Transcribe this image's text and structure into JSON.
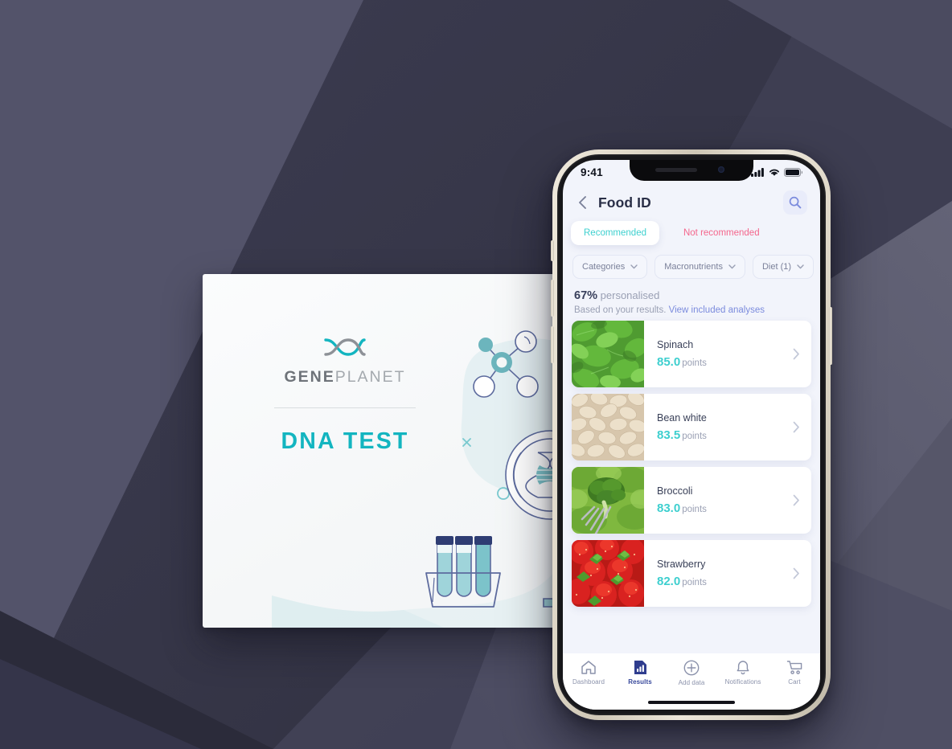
{
  "background": {
    "style": "low-poly-dark-polygons",
    "base_color": "#4a4a5e",
    "dark_color": "#35354a",
    "light_color": "#5a5a70"
  },
  "promo_card": {
    "brand_bold": "GENE",
    "brand_light": "PLANET",
    "product_title": "DNA TEST",
    "logo_icon": "dna-helix-icon",
    "accent_color": "#13b5c0",
    "illustration_items": [
      "molecule-icon",
      "dna-magnifier-icon",
      "test-tubes-icon",
      "microscope-icon",
      "cross-mark-icon",
      "small-circle-icon"
    ]
  },
  "phone": {
    "status_bar": {
      "time": "9:41",
      "signal_icon": "cellular-bars-icon",
      "wifi_icon": "wifi-icon",
      "battery_icon": "battery-full-icon"
    },
    "header": {
      "back_icon": "chevron-left-icon",
      "title": "Food ID",
      "search_icon": "search-icon"
    },
    "segments": [
      {
        "label": "Recommended",
        "active": true,
        "color": "#3ed0cf"
      },
      {
        "label": "Not recommended",
        "active": false,
        "color": "#f4668c"
      }
    ],
    "filters": [
      {
        "label": "Categories",
        "icon": "chevron-down-icon"
      },
      {
        "label": "Macronutrients",
        "icon": "chevron-down-icon"
      },
      {
        "label": "Diet (1)",
        "icon": "chevron-down-icon"
      }
    ],
    "personalised": {
      "percent": "67%",
      "percent_suffix": "personalised",
      "subtitle": "Based on your results.",
      "link": "View included analyses"
    },
    "foods": [
      {
        "name": "Spinach",
        "points": "85.0",
        "points_unit": "points",
        "image": "spinach-leaves-photo",
        "chevron": "chevron-right-icon"
      },
      {
        "name": "Bean white",
        "points": "83.5",
        "points_unit": "points",
        "image": "white-beans-photo",
        "chevron": "chevron-right-icon"
      },
      {
        "name": "Broccoli",
        "points": "83.0",
        "points_unit": "points",
        "image": "broccoli-fork-photo",
        "chevron": "chevron-right-icon"
      },
      {
        "name": "Strawberry",
        "points": "82.0",
        "points_unit": "points",
        "image": "strawberries-photo",
        "chevron": "chevron-right-icon"
      }
    ],
    "tabbar": [
      {
        "label": "Dashboard",
        "icon": "home-icon",
        "active": false
      },
      {
        "label": "Results",
        "icon": "bar-chart-doc-icon",
        "active": true
      },
      {
        "label": "Add data",
        "icon": "plus-circle-icon",
        "active": false
      },
      {
        "label": "Notifications",
        "icon": "bell-icon",
        "active": false
      },
      {
        "label": "Cart",
        "icon": "shopping-cart-icon",
        "active": false
      }
    ]
  }
}
